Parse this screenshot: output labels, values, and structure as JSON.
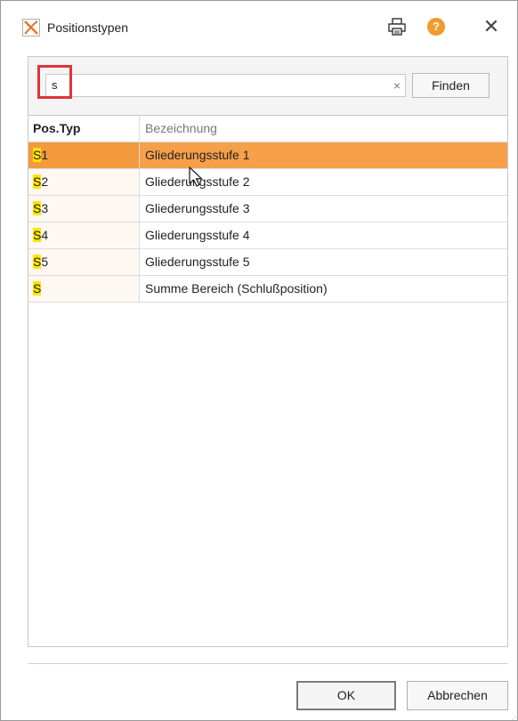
{
  "window": {
    "title": "Positionstypen"
  },
  "icons": {
    "app": "app-logo-icon",
    "print": "printer-icon",
    "help": "help-icon",
    "close": "close-icon",
    "clear": "clear-icon"
  },
  "search": {
    "value": "s",
    "clear_symbol": "×",
    "find_label": "Finden"
  },
  "grid": {
    "columns": [
      "Pos.Typ",
      "Bezeichnung"
    ],
    "match": "S",
    "rows": [
      {
        "match": "S",
        "rest": "1",
        "bezeichnung": "Gliederungsstufe 1",
        "selected": true
      },
      {
        "match": "S",
        "rest": "2",
        "bezeichnung": "Gliederungsstufe 2"
      },
      {
        "match": "S",
        "rest": "3",
        "bezeichnung": "Gliederungsstufe 3"
      },
      {
        "match": "S",
        "rest": "4",
        "bezeichnung": "Gliederungsstufe 4"
      },
      {
        "match": "S",
        "rest": "5",
        "bezeichnung": "Gliederungsstufe 5"
      },
      {
        "match": "S",
        "rest": "",
        "bezeichnung": "Summe Bereich (Schlußposition)"
      }
    ]
  },
  "footer": {
    "ok_label": "OK",
    "cancel_label": "Abbrechen"
  },
  "colors": {
    "accent": "#f7a04a",
    "highlight": "#ffe500",
    "search_focus": "#e0343a",
    "help": "#f29a2e"
  }
}
